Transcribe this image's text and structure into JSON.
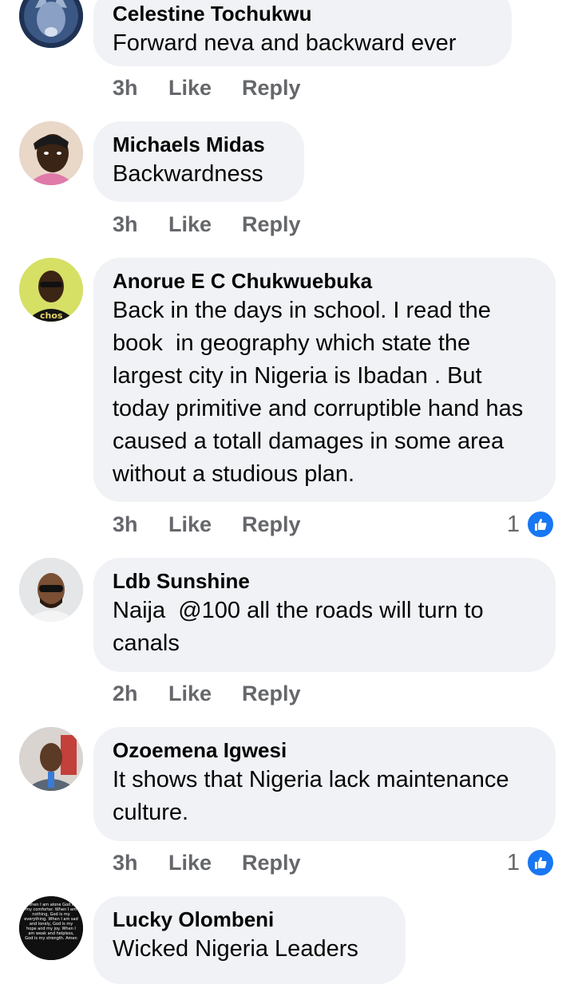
{
  "comments": [
    {
      "author": "Celestine Tochukwu",
      "text": "Forward neva and backward ever",
      "time": "3h",
      "like": "Like",
      "reply": "Reply"
    },
    {
      "author": "Michaels Midas",
      "text": "Backwardness",
      "time": "3h",
      "like": "Like",
      "reply": "Reply"
    },
    {
      "author": "Anorue E C Chukwuebuka",
      "text": "Back in the days in school. I read the book  in geography which state the largest city in Nigeria is Ibadan . But today primitive and corruptible hand has caused a totall damages in some area without a studious plan.",
      "time": "3h",
      "like": "Like",
      "reply": "Reply",
      "reactions": "1",
      "avatar_text": "chos"
    },
    {
      "author": "Ldb Sunshine",
      "text": "Naija  @100 all the roads will turn to canals",
      "time": "2h",
      "like": "Like",
      "reply": "Reply"
    },
    {
      "author": "Ozoemena Igwesi",
      "text": "It shows that Nigeria lack maintenance culture.",
      "time": "3h",
      "like": "Like",
      "reply": "Reply",
      "reactions": "1"
    },
    {
      "author": "Lucky Olombeni",
      "text": "Wicked Nigeria Leaders",
      "avatar_text": "When I am alone God is my comforter. When I am nothing, God is my everything. When I am sad and lonely, God is my hope and my joy. When I am weak and helpless, God is my strength. Amen"
    }
  ],
  "colors": {
    "bubble": "#f0f2f5",
    "meta": "#65676b",
    "like_blue": "#1877f2"
  },
  "icons": {
    "reaction": "thumbs-up-icon"
  }
}
